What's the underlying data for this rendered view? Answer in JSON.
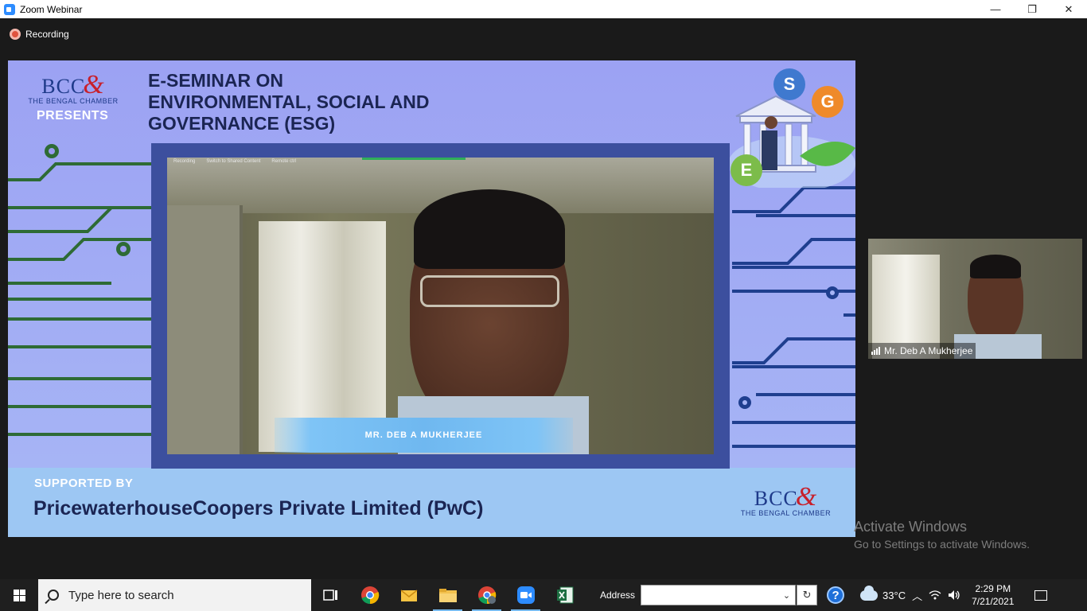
{
  "window": {
    "title": "Zoom Webinar",
    "controls": {
      "minimize": "—",
      "maximize": "❐",
      "close": "✕"
    }
  },
  "recording": {
    "label": "Recording"
  },
  "slide": {
    "logo_mark": "BCC",
    "logo_amp": "&",
    "logo_sub": "THE BENGAL CHAMBER",
    "presents": "PRESENTS",
    "title_lines": [
      "E-SEMINAR ON",
      "ENVIRONMENTAL, SOCIAL AND",
      "GOVERNANCE (ESG)"
    ],
    "esg_letters": {
      "e": "E",
      "s": "S",
      "g": "G"
    },
    "supported_by": "SUPPORTED BY",
    "sponsor": "PricewaterhouseCoopers Private Limited (PwC)",
    "logo_bottom_mark": "BCC",
    "logo_bottom_amp": "&",
    "logo_bottom_sub": "THE BENGAL CHAMBER",
    "colors": {
      "slide_bg": "#9a9cf0",
      "circuit_green": "#2e6b35",
      "circuit_blue": "#1f3f8f",
      "navy": "#1b2553",
      "frame": "#3c4f9e"
    }
  },
  "presenter_video": {
    "mini_toolbar": [
      "Recording",
      "Switch to Shared Content",
      "Remote ctrl"
    ],
    "name_banner": "MR. DEB A MUKHERJEE"
  },
  "participant": {
    "name": "Mr. Deb A Mukherjee"
  },
  "watermark": {
    "title": "Activate Windows",
    "subtitle": "Go to Settings to activate Windows."
  },
  "taskbar": {
    "search_placeholder": "Type here to search",
    "apps": [
      "task-view",
      "chrome",
      "mail",
      "file-explorer",
      "chrome-profile",
      "zoom",
      "excel"
    ],
    "address_label": "Address",
    "address_value": "",
    "weather": "33°C",
    "time": "2:29 PM",
    "date": "7/21/2021"
  }
}
